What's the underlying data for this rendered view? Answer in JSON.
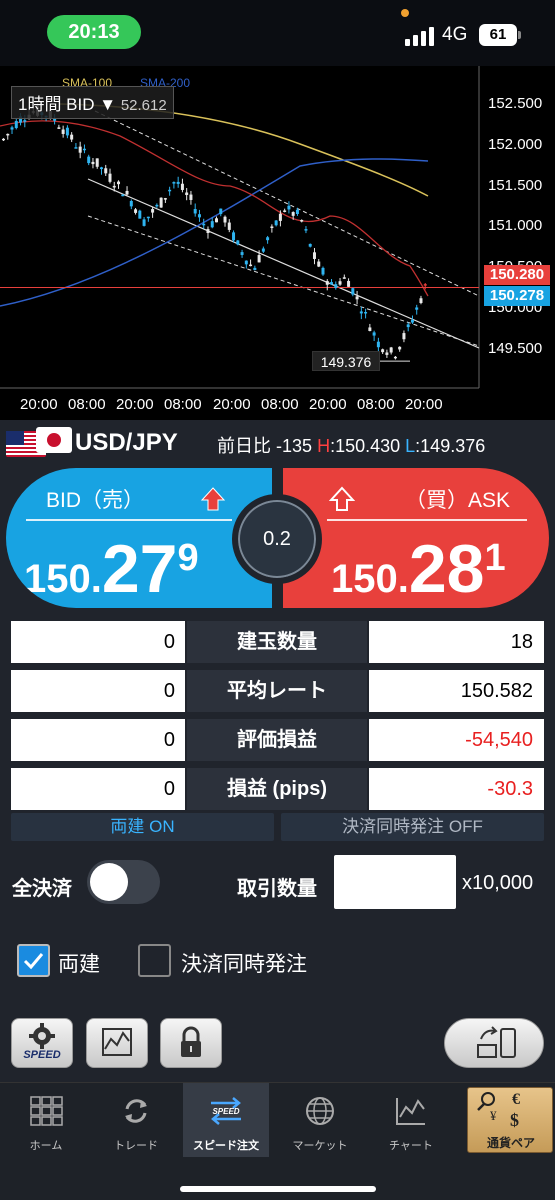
{
  "status_bar": {
    "time": "20:13",
    "network": "4G",
    "battery": "61"
  },
  "chart": {
    "timeframe": "1時間 BID ▼",
    "indicators": [
      "SMA-100",
      "SMA-200"
    ],
    "partial_price_label": "52.612",
    "y_axis_labels": [
      "152.500",
      "152.000",
      "151.500",
      "151.000",
      "150.500",
      "150.000",
      "149.500"
    ],
    "x_axis_labels": [
      "20:00",
      "08:00",
      "20:00",
      "08:00",
      "20:00",
      "08:00",
      "20:00",
      "08:00",
      "20:00"
    ],
    "ask_tag": "150.280",
    "bid_tag": "150.278",
    "low_tag": "149.376",
    "colors": {
      "ask": "#e8403c",
      "bid": "#18a3e2",
      "sma100": "#d9c15a",
      "sma200": "#2f5fc8",
      "ma_short": "#c03030"
    }
  },
  "pair": {
    "name": "USD/JPY",
    "change_label": "前日比",
    "change_value": "-135",
    "high_label": "H",
    "high_value": ":150.430",
    "low_label": "L",
    "low_value": ":149.376"
  },
  "bid": {
    "label": "BID（売）",
    "price_small": "150.",
    "price_big": "27",
    "price_tail": "9"
  },
  "ask": {
    "label": "（買）ASK",
    "price_small": "150.",
    "price_big": "28",
    "price_tail": "1"
  },
  "spread": "0.2",
  "positions": [
    {
      "left": "0",
      "label": "建玉数量",
      "right": "18",
      "negative": false
    },
    {
      "left": "0",
      "label": "平均レート",
      "right": "150.582",
      "negative": false
    },
    {
      "left": "0",
      "label": "評価損益",
      "right": "-54,540",
      "negative": true
    },
    {
      "left": "0",
      "label": "損益 (pips)",
      "right": "-30.3",
      "negative": true
    }
  ],
  "modes": {
    "hedge": "両建 ON",
    "simultaneous": "決済同時発注 OFF"
  },
  "close_all_label": "全決済",
  "trade_qty_label": "取引数量",
  "trade_qty_value": "",
  "unit_label": "x10,000",
  "checkboxes": {
    "hedge_label": "両建",
    "simultaneous_label": "決済同時発注"
  },
  "tools": {
    "speed_label": "SPEED"
  },
  "tabs": [
    {
      "label": "ホーム"
    },
    {
      "label": "トレード"
    },
    {
      "label": "スピード注文"
    },
    {
      "label": "マーケット"
    },
    {
      "label": "チャート"
    },
    {
      "label": "通貨ペア"
    }
  ]
}
